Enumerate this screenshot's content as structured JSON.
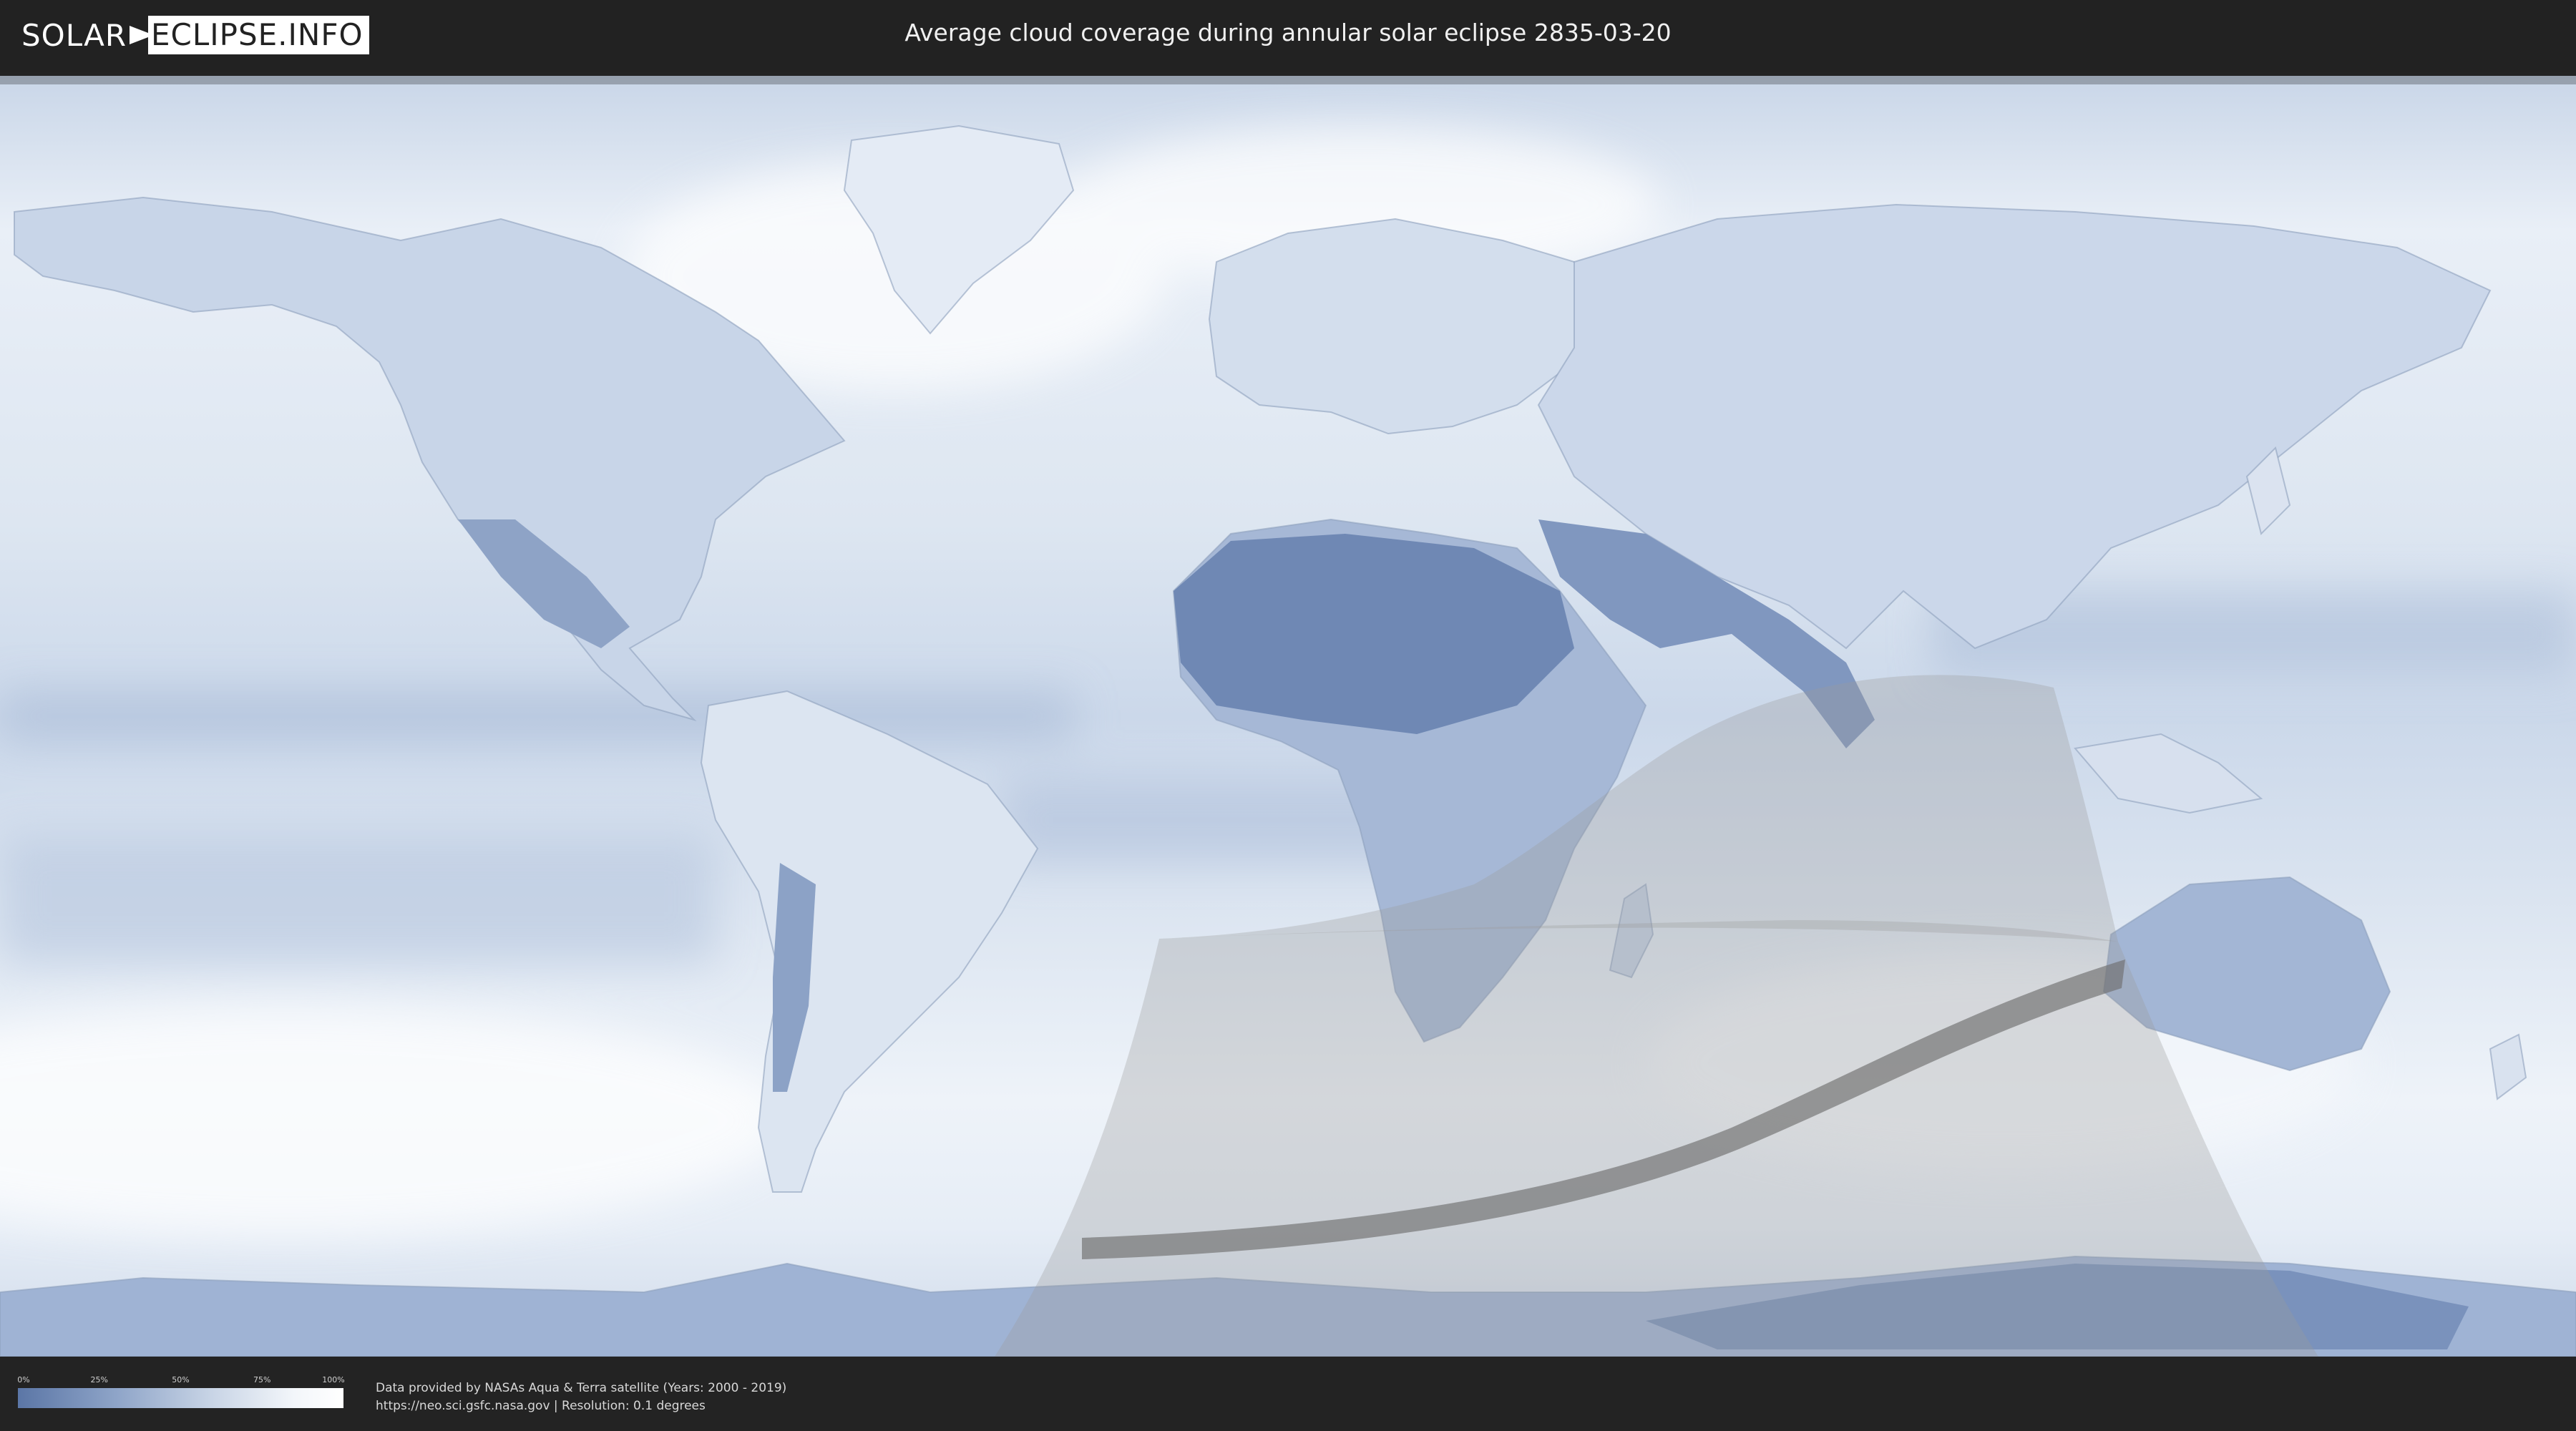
{
  "header": {
    "logo_left": "SOLAR",
    "logo_right": "ECLIPSE.INFO",
    "title": "Average cloud coverage during annular solar eclipse 2835-03-20"
  },
  "legend": {
    "ticks": [
      "0%",
      "25%",
      "50%",
      "75%",
      "100%"
    ],
    "tick_fractions": [
      0.0,
      0.25,
      0.5,
      0.75,
      1.0
    ],
    "gradient_colors": [
      "#5b76a6",
      "#8ea4c8",
      "#c9d5e6",
      "#f3f6fa",
      "#ffffff"
    ]
  },
  "footer": {
    "credit_line1": "Data provided by NASAs Aqua & Terra satellite (Years: 2000 - 2019)",
    "credit_line2": "https://neo.sci.gsfc.nasa.gov | Resolution: 0.1 degrees"
  },
  "colors": {
    "background": "#232323",
    "ocean_cloud": "#dfe7f1",
    "land_clear": "#6f88b4",
    "land_mid": "#a9bcd8",
    "eclipse_shadow": "#9a9a9a",
    "central_path": "#6e6e6e"
  },
  "map": {
    "projection": "equirectangular",
    "eclipse_type": "annular",
    "eclipse_date": "2835-03-20"
  }
}
